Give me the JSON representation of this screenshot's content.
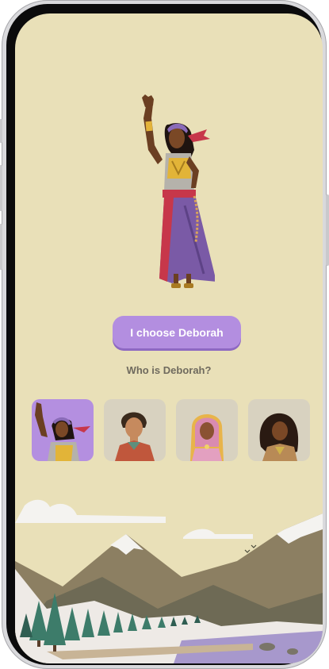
{
  "screen": {
    "background": "#e9e0b8",
    "accent": "#b38ee0"
  },
  "hero": {
    "character_name": "Deborah"
  },
  "actions": {
    "choose_label": "I choose Deborah",
    "who_label": "Who is Deborah?"
  },
  "characters": [
    {
      "name": "deborah",
      "selected": true
    },
    {
      "name": "young-man",
      "selected": false
    },
    {
      "name": "woman-headscarf",
      "selected": false
    },
    {
      "name": "woman-curly-hair",
      "selected": false
    }
  ]
}
